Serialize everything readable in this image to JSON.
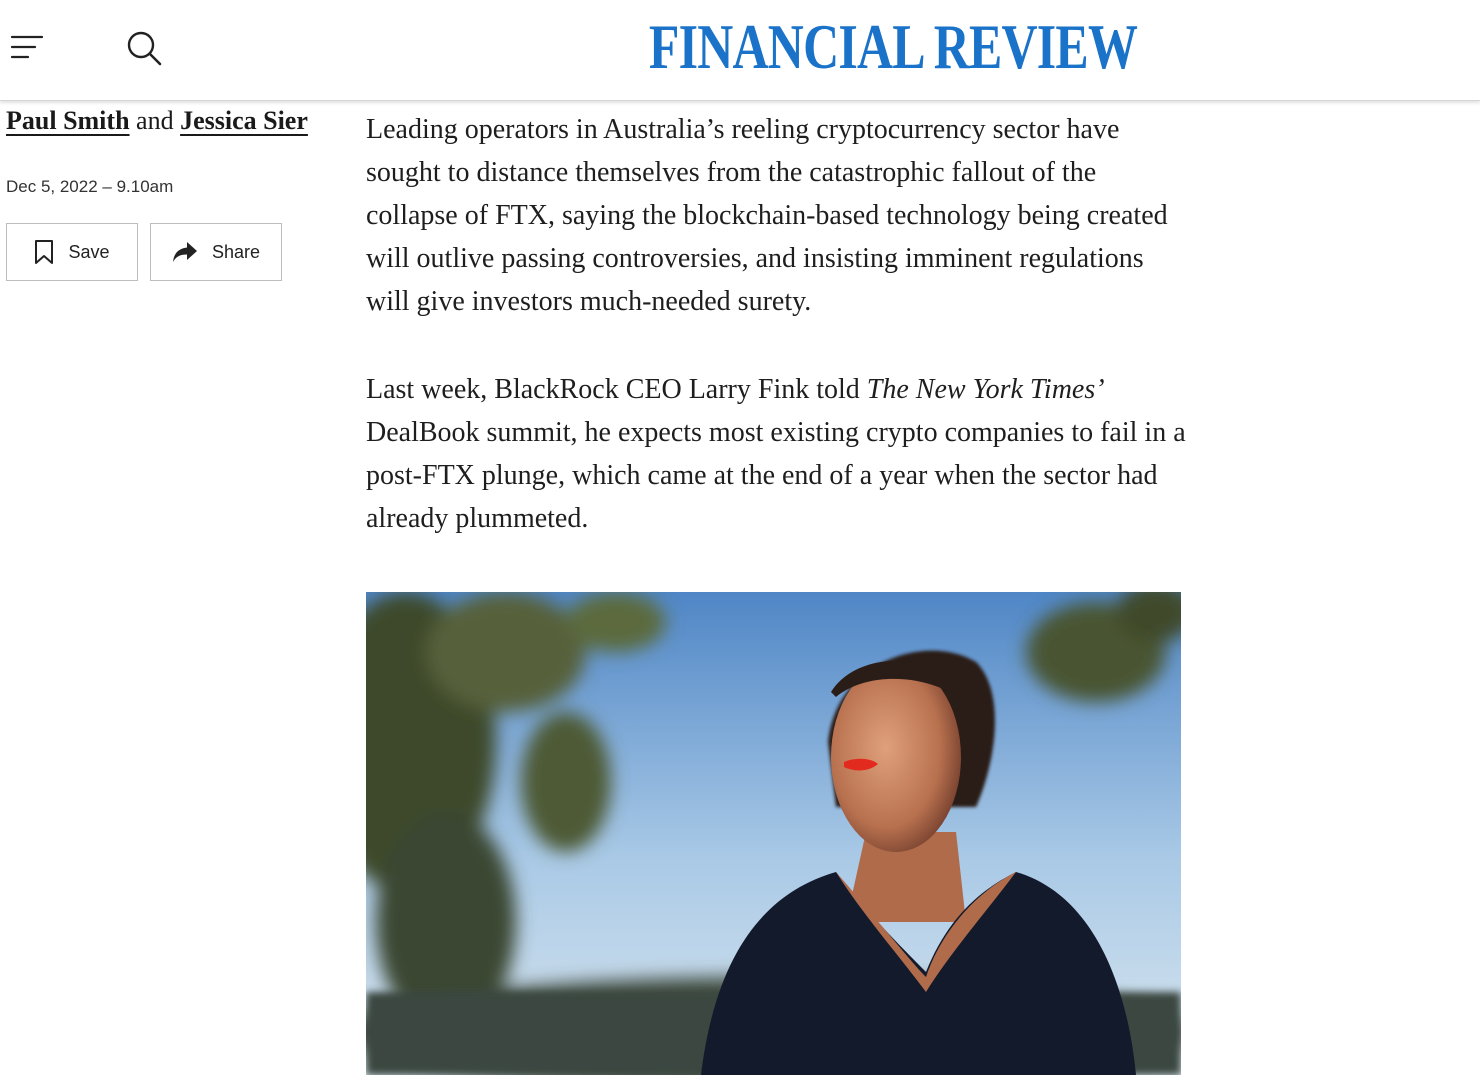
{
  "header": {
    "brand": "FINANCIAL REVIEW",
    "brand_color": "#1a73c8",
    "menu_icon": "menu-icon",
    "search_icon": "search-icon"
  },
  "byline": {
    "author1": "Paul Smith",
    "conjunction": "and",
    "author2": "Jessica Sier",
    "date": "Dec 5, 2022 – 9.10am"
  },
  "actions": {
    "save_label": "Save",
    "save_icon": "bookmark-icon",
    "share_label": "Share",
    "share_icon": "share-arrow-icon"
  },
  "article": {
    "p1": "Leading operators in Australia’s reeling cryptocurrency sector have sought to distance themselves from the catastrophic fallout of the collapse of FTX, saying the blockchain-based technology being created will outlive passing controversies, and insisting imminent regulations will give investors much-needed surety.",
    "p2_before": "Last week, BlackRock CEO Larry Fink told ",
    "p2_italic": "The New York Times’",
    "p2_after": " DealBook summit, he expects most existing crypto companies to fail in a post-FTX plunge, which came at the end of a year when the sector had already plummeted."
  }
}
